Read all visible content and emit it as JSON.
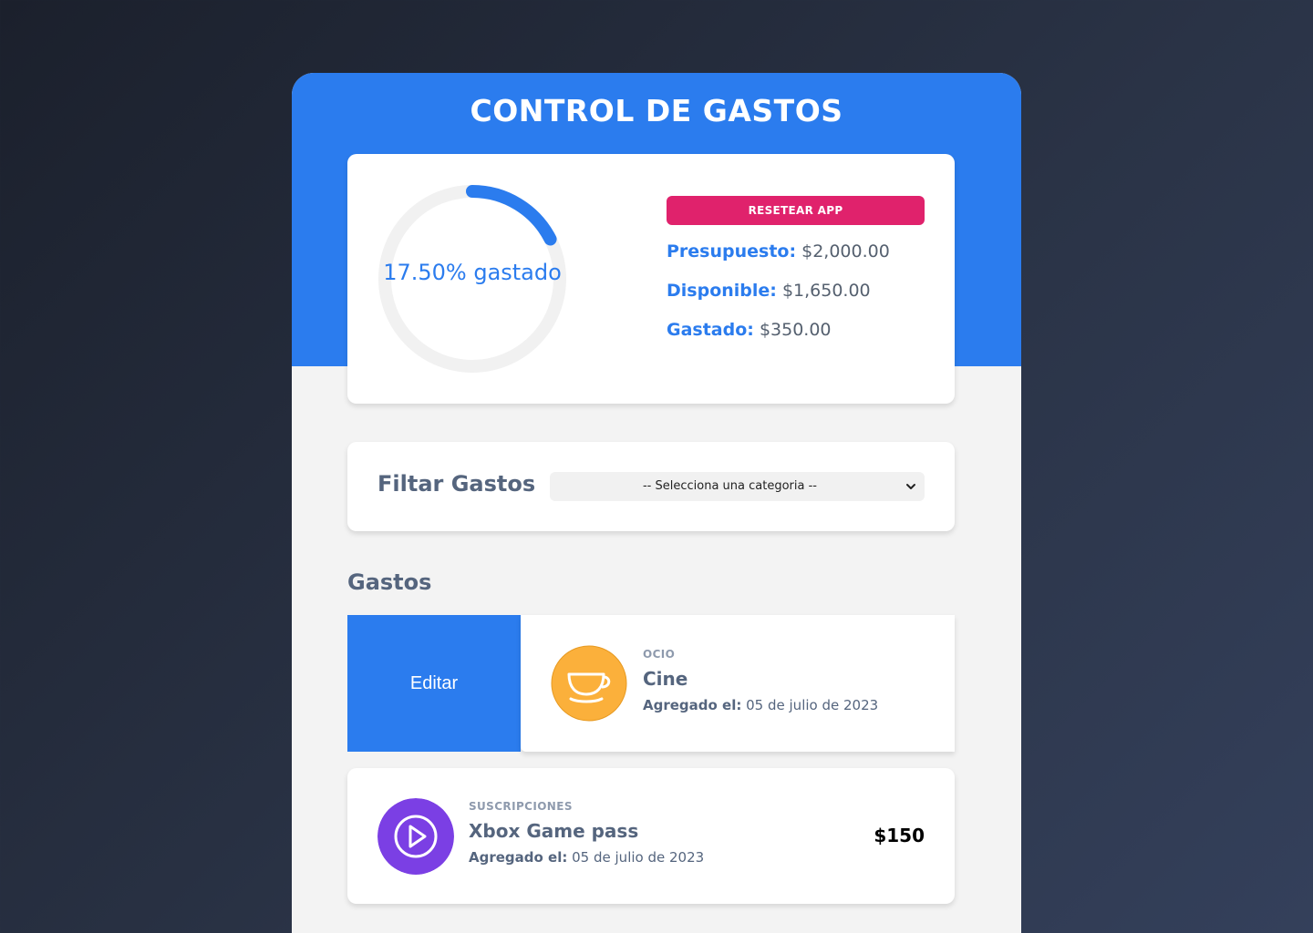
{
  "app": {
    "title": "CONTROL DE GASTOS"
  },
  "budget": {
    "percent_label": "17.50% gastado",
    "percent_spent": 17.5,
    "reset_label": "RESETEAR APP",
    "presupuesto_label": "Presupuesto:",
    "presupuesto_value": "$2,000.00",
    "disponible_label": "Disponible:",
    "disponible_value": "$1,650.00",
    "gastado_label": "Gastado:",
    "gastado_value": "$350.00"
  },
  "filter": {
    "title": "Filtar Gastos",
    "selected": "-- Selecciona una categoria --"
  },
  "expenses": {
    "section_title": "Gastos",
    "edit_label": "Editar",
    "added_label": "Agregado el:",
    "items": [
      {
        "category": "OCIO",
        "name": "Cine",
        "date": "05 de julio de 2023",
        "icon": "coffee-cup-icon",
        "color": "#fbb03b"
      },
      {
        "category": "SUSCRIPCIONES",
        "name": "Xbox Game pass",
        "date": "05 de julio de 2023",
        "amount": "$150",
        "icon": "play-icon",
        "color": "#7b3fe4"
      }
    ]
  },
  "colors": {
    "primary": "#2b7cee",
    "reset": "#e0226c",
    "text_dark": "#55657e"
  }
}
